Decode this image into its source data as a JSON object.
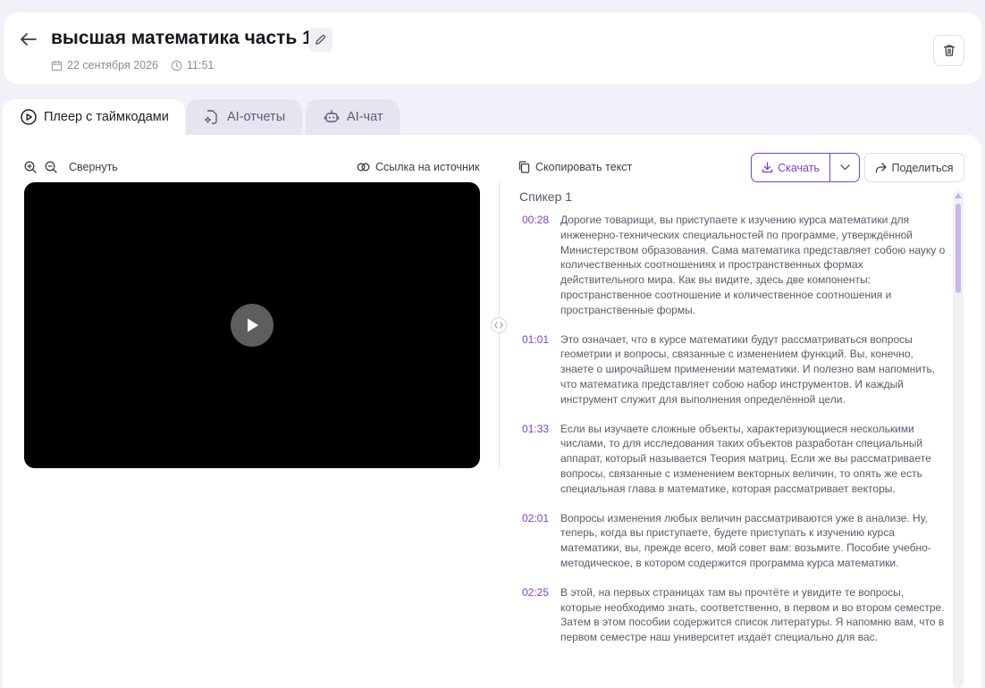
{
  "header": {
    "title": "высшая математика часть 1",
    "date": "22 сентября 2026",
    "time": "11:51"
  },
  "tabs": [
    {
      "label": "Плеер с таймкодами",
      "active": true
    },
    {
      "label": "AI-отчеты",
      "active": false
    },
    {
      "label": "AI-чат",
      "active": false
    }
  ],
  "player": {
    "collapse_label": "Свернуть",
    "source_link_label": "Ссылка на источник"
  },
  "toolbar": {
    "copy_label": "Скопировать текст",
    "download_label": "Скачать",
    "share_label": "Поделиться"
  },
  "transcript": {
    "speaker": "Спикер 1",
    "segments": [
      {
        "time": "00:28",
        "text": "Дорогие товарищи, вы приступаете к изучению курса математики для инженерно-технических специальностей по программе, утверждённой Министерством образования. Сама математика представляет собою науку о количественных соотношениях и пространственных формах действительного мира. Как вы видите, здесь две компоненты: пространственное соотношение и количественное соотношения и пространственные формы."
      },
      {
        "time": "01:01",
        "text": "Это означает, что в курсе математики будут рассматриваться вопросы геометрии и вопросы, связанные с изменением функций. Вы, конечно, знаете о широчайшем применении математики. И полезно вам напомнить, что математика представляет собою набор инструментов. И каждый инструмент служит для выполнения определённой цели."
      },
      {
        "time": "01:33",
        "text": "Если вы изучаете сложные объекты, характеризующиеся несколькими числами, то для исследования таких объектов разработан специальный аппарат, который называется Теория матриц. Если же вы рассматриваете вопросы, связанные с изменением векторных величин, то опять же есть специальная глава в математике, которая рассматривает векторы."
      },
      {
        "time": "02:01",
        "text": "Вопросы изменения любых величин рассматриваются уже в анализе. Ну, теперь, когда вы приступаете, будете приступать к изучению курса математики, вы, прежде всего, мой совет вам: возьмите. Пособие учебно-методическое, в котором содержится программа курса математики."
      },
      {
        "time": "02:25",
        "text": "В этой, на первых страницах там вы прочтёте и увидите те вопросы, которые необходимо знать, соответственно, в первом и во втором семестре. Затем в этом пособии содержится список литературы. Я напомню вам, что в первом семестре наш университет издаёт специально для вас."
      }
    ]
  },
  "colors": {
    "accent": "#7b3fd6",
    "background": "#f1f1f9"
  }
}
